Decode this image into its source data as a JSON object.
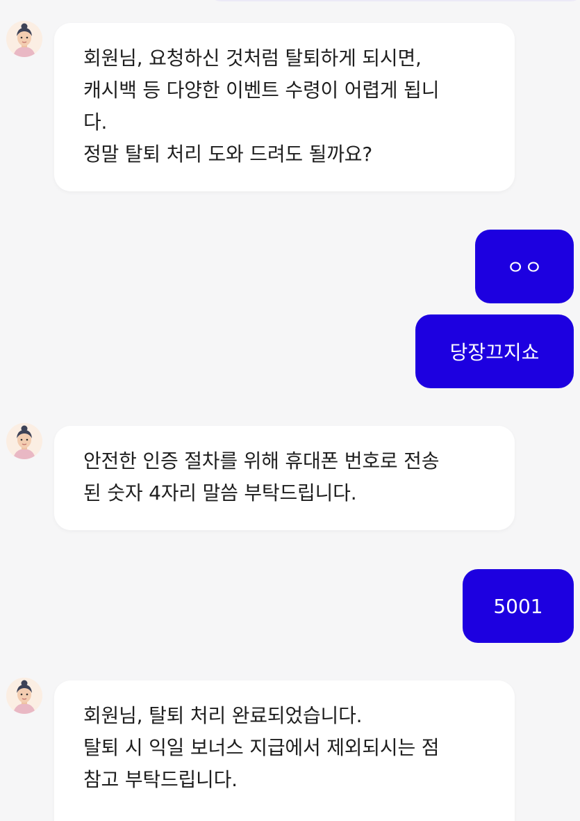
{
  "colors": {
    "background": "#f6f6f7",
    "bot_bubble": "#ffffff",
    "user_bubble": "#1d00e0",
    "user_text": "#ffffff",
    "bot_text": "#1e1e1e"
  },
  "messages": [
    {
      "sender": "bot",
      "avatar_icon": "agent-avatar-icon",
      "text": "회원님, 요청하신 것처럼 탈퇴하게 되시면,\n캐시백 등 다양한 이벤트 수령이 어렵게 됩니\n다.\n정말 탈퇴 처리 도와 드려도 될까요?"
    },
    {
      "sender": "user",
      "text": "ㅇㅇ"
    },
    {
      "sender": "user",
      "text": "당장끄지쇼"
    },
    {
      "sender": "bot",
      "avatar_icon": "agent-avatar-icon",
      "text": "안전한 인증 절차를 위해 휴대폰 번호로 전송\n된 숫자 4자리 말씀 부탁드립니다."
    },
    {
      "sender": "user",
      "text": "5001"
    },
    {
      "sender": "bot",
      "avatar_icon": "agent-avatar-icon",
      "text": "회원님, 탈퇴 처리 완료되었습니다.\n탈퇴 시 익일 보너스 지급에서 제외되시는 점\n참고 부탁드립니다."
    }
  ]
}
